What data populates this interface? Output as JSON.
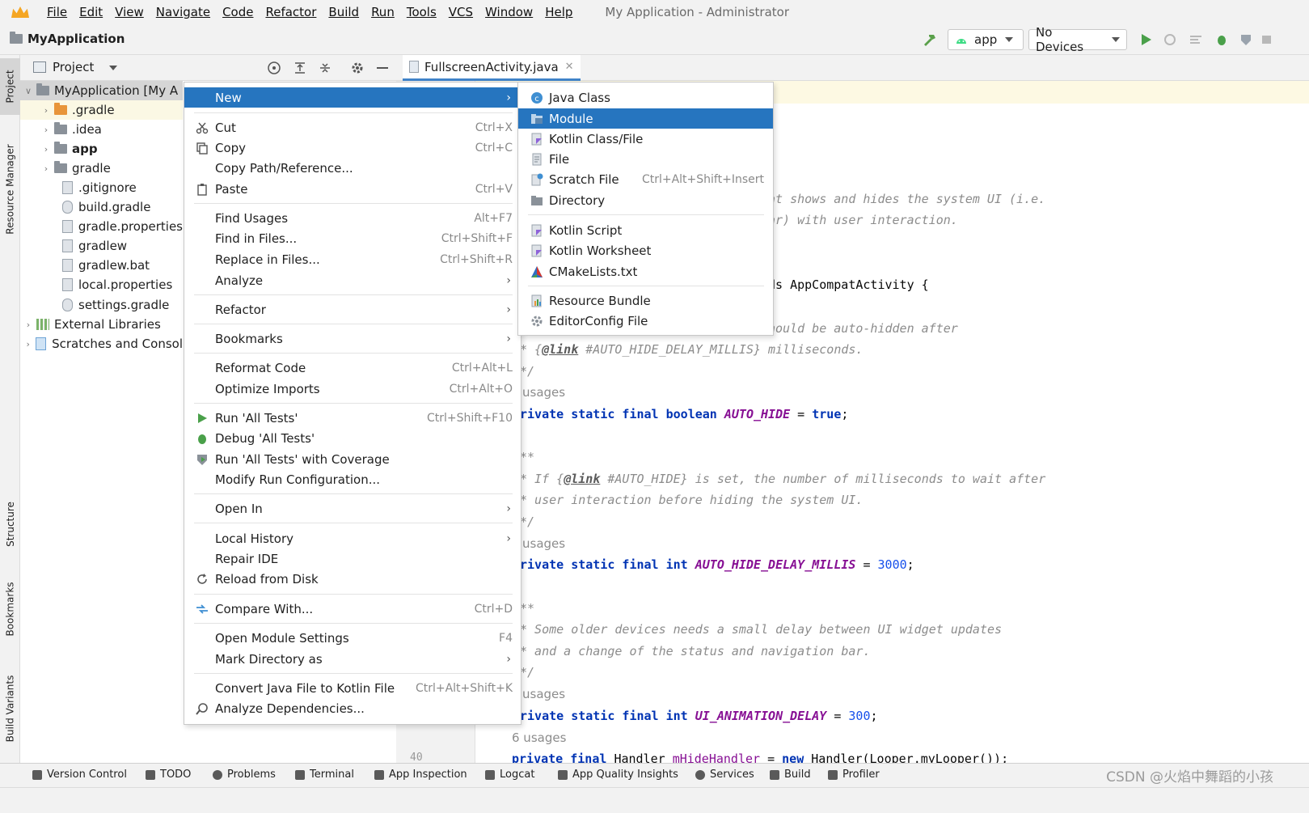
{
  "menubar": {
    "items": [
      "File",
      "Edit",
      "View",
      "Navigate",
      "Code",
      "Refactor",
      "Build",
      "Run",
      "Tools",
      "VCS",
      "Window",
      "Help"
    ],
    "window_title": "My Application - Administrator"
  },
  "toolbar": {
    "project_name": "MyApplication",
    "run_config": "app",
    "device": "No Devices"
  },
  "left_stripe": {
    "tabs": [
      "Project",
      "Resource Manager",
      "Structure",
      "Bookmarks",
      "Build Variants"
    ]
  },
  "project_panel": {
    "view_label": "Project",
    "tree": [
      {
        "label": "MyApplication [My A",
        "bold": true
      },
      {
        "label": ".gradle"
      },
      {
        "label": ".idea"
      },
      {
        "label": "app"
      },
      {
        "label": "gradle"
      },
      {
        "label": ".gitignore"
      },
      {
        "label": "build.gradle"
      },
      {
        "label": "gradle.properties"
      },
      {
        "label": "gradlew"
      },
      {
        "label": "gradlew.bat"
      },
      {
        "label": "local.properties"
      },
      {
        "label": "settings.gradle"
      },
      {
        "label": "External Libraries"
      },
      {
        "label": "Scratches and Consol"
      }
    ]
  },
  "editor": {
    "tab_label": "FullscreenActivity.java",
    "line_number": "40",
    "hints": [
      "usages",
      "usages",
      "usages",
      "6 usages"
    ],
    "code_lines": {
      "l1": "at shows and hides the system UI (i.e.",
      "l2": "ar) with user interaction.",
      "l3": "ds AppCompatActivity {",
      "l4": "hould be auto-hidden after",
      "l5_a": "* {",
      "l5_tag": "@link",
      "l5_b": " #AUTO_HIDE_DELAY_MILLIS} milliseconds.",
      "l6": "*/",
      "l7_kw": "rivate static final boolean ",
      "l7_cn": "AUTO_HIDE",
      "l7_eq": " = ",
      "l7_val": "true",
      "l7_end": ";",
      "l8": "**",
      "l9_a": "* If {",
      "l9_tag": "@link",
      "l9_b": " #AUTO_HIDE} is set, the number of milliseconds to wait after",
      "l10": "* user interaction before hiding the system UI.",
      "l11": "*/",
      "l12_kw": "rivate static final int ",
      "l12_cn": "AUTO_HIDE_DELAY_MILLIS",
      "l12_eq": " = ",
      "l12_val": "3000",
      "l12_end": ";",
      "l13": "**",
      "l14": "* Some older devices needs a small delay between UI widget updates",
      "l15": "* and a change of the status and navigation bar.",
      "l16": "*/",
      "l17_kw": "rivate static final int ",
      "l17_cn": "UI_ANIMATION_DELAY",
      "l17_eq": " = ",
      "l17_val": "300",
      "l17_end": ";",
      "l18_kw1": "private final ",
      "l18_type": "Handler ",
      "l18_fld": "mHideHandler",
      "l18_eq": " = ",
      "l18_kw2": "new ",
      "l18_rest": "Handler(Looper.myLooper());"
    }
  },
  "context_menu": {
    "new": "New",
    "cut": "Cut",
    "cut_sc": "Ctrl+X",
    "copy": "Copy",
    "copy_sc": "Ctrl+C",
    "copy_path": "Copy Path/Reference...",
    "paste": "Paste",
    "paste_sc": "Ctrl+V",
    "find_usages": "Find Usages",
    "find_usages_sc": "Alt+F7",
    "find_in_files": "Find in Files...",
    "find_in_files_sc": "Ctrl+Shift+F",
    "replace_in_files": "Replace in Files...",
    "replace_in_files_sc": "Ctrl+Shift+R",
    "analyze": "Analyze",
    "refactor": "Refactor",
    "bookmarks": "Bookmarks",
    "reformat": "Reformat Code",
    "reformat_sc": "Ctrl+Alt+L",
    "optimize": "Optimize Imports",
    "optimize_sc": "Ctrl+Alt+O",
    "run_tests": "Run 'All Tests'",
    "run_tests_sc": "Ctrl+Shift+F10",
    "debug_tests": "Debug 'All Tests'",
    "run_coverage": "Run 'All Tests' with Coverage",
    "modify_run": "Modify Run Configuration...",
    "open_in": "Open In",
    "local_history": "Local History",
    "repair_ide": "Repair IDE",
    "reload": "Reload from Disk",
    "compare": "Compare With...",
    "compare_sc": "Ctrl+D",
    "module_settings": "Open Module Settings",
    "module_settings_sc": "F4",
    "mark_dir": "Mark Directory as",
    "convert": "Convert Java File to Kotlin File",
    "convert_sc": "Ctrl+Alt+Shift+K",
    "analyze_deps": "Analyze Dependencies..."
  },
  "submenu": {
    "java_class": "Java Class",
    "module": "Module",
    "kotlin_class": "Kotlin Class/File",
    "file": "File",
    "scratch": "Scratch File",
    "scratch_sc": "Ctrl+Alt+Shift+Insert",
    "directory": "Directory",
    "kotlin_script": "Kotlin Script",
    "kotlin_worksheet": "Kotlin Worksheet",
    "cmake": "CMakeLists.txt",
    "resource_bundle": "Resource Bundle",
    "editorconfig": "EditorConfig File"
  },
  "bottom_tools": [
    "Version Control",
    "TODO",
    "Problems",
    "Terminal",
    "App Inspection",
    "Logcat",
    "App Quality Insights",
    "Services",
    "Build",
    "Profiler"
  ],
  "watermark": "CSDN @火焰中舞蹈的小孩",
  "colors": {
    "selection": "#2675bf",
    "keyword": "#0033b3",
    "constant": "#871094",
    "number": "#1750eb",
    "comment": "#8c8c8c"
  }
}
